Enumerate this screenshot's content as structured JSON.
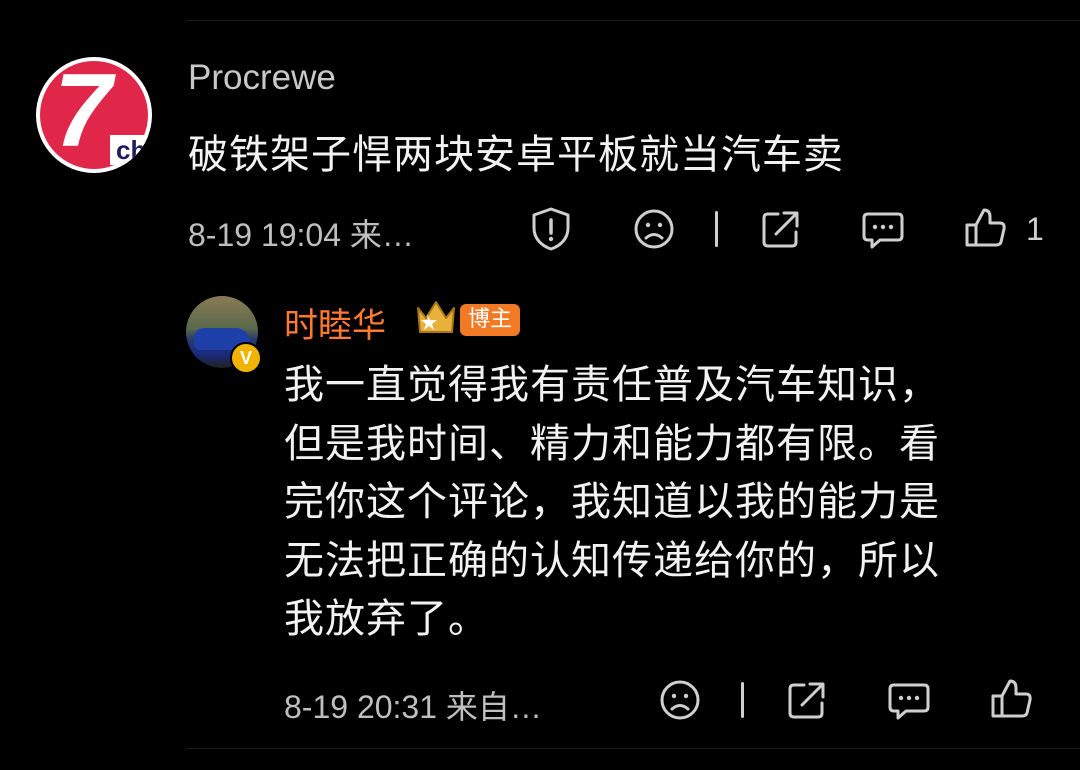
{
  "comment": {
    "author": "Procrewe",
    "avatar_text": "7",
    "avatar_sub": "ch",
    "text": "破铁架子悍两块安卓平板就当汽车卖",
    "meta": "8-19 19:04  来…",
    "like_count": "1",
    "icons": [
      "report-icon",
      "dislike-face-icon",
      "share-icon",
      "comment-icon",
      "like-icon"
    ]
  },
  "reply": {
    "author": "时睦华",
    "badge": "博主",
    "verified_mark": "V",
    "text_lines": [
      "我一直觉得我有责任普及汽车知识，",
      "但是我时间、精力和能力都有限。看",
      "完你这个评论，我知道以我的能力是",
      "无法把正确的认知传递给你的，所以",
      "我放弃了。"
    ],
    "meta": "8-19 20:31  来自…",
    "icons": [
      "dislike-face-icon",
      "share-icon",
      "comment-icon",
      "like-icon"
    ]
  },
  "colors": {
    "background": "#000000",
    "accent_name": "#ff7a2e",
    "badge": "#f37a24",
    "verified": "#f0b400"
  }
}
